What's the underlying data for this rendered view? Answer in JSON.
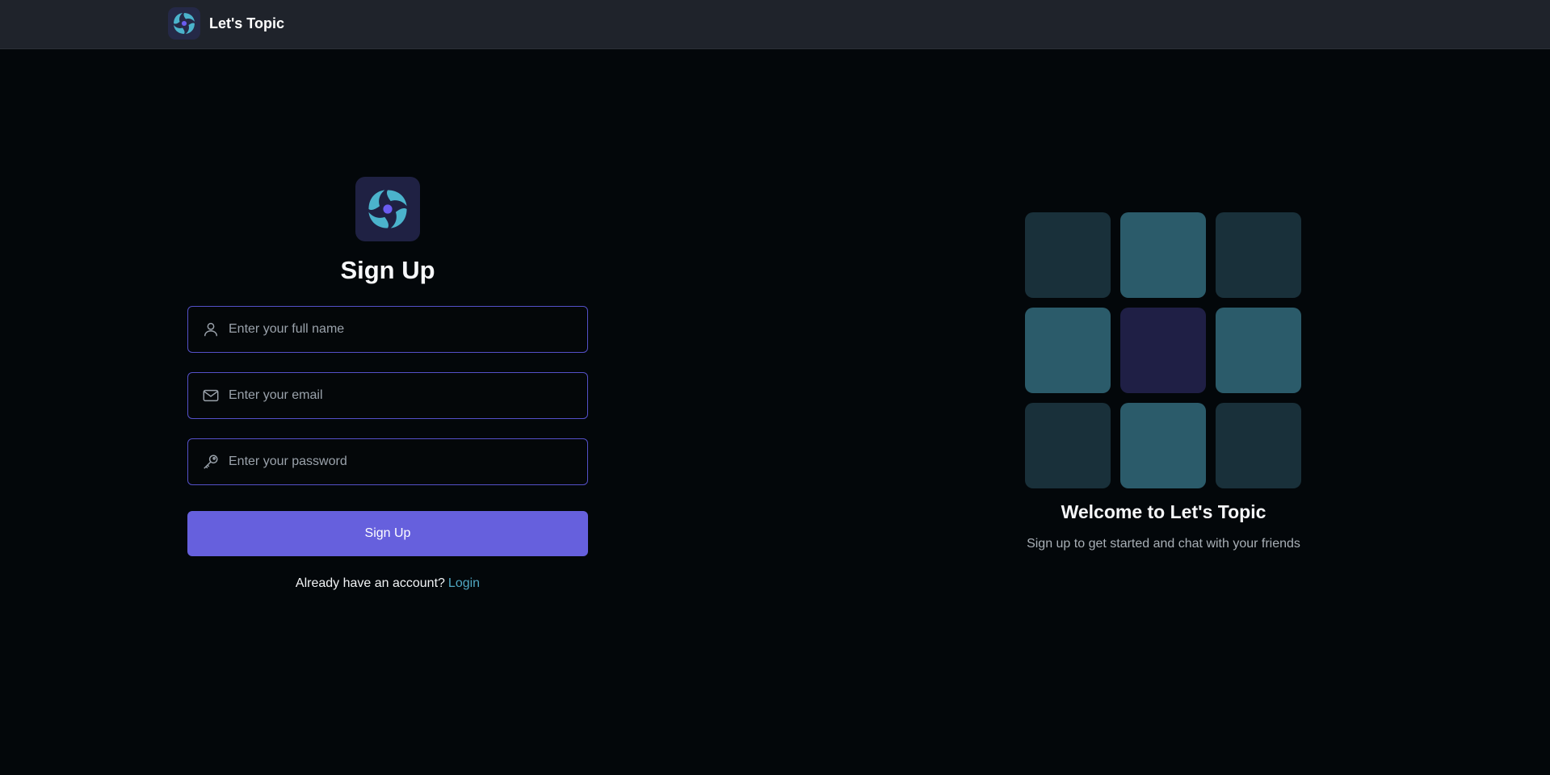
{
  "app": {
    "brand_name": "Let's Topic",
    "logo_icon": "swirl-logo-icon"
  },
  "signup": {
    "title": "Sign Up",
    "fields": [
      {
        "name": "full-name",
        "placeholder": "Enter your full name",
        "icon": "user-icon",
        "value": ""
      },
      {
        "name": "email",
        "placeholder": "Enter your email",
        "icon": "mail-icon",
        "value": ""
      },
      {
        "name": "password",
        "placeholder": "Enter your password",
        "icon": "key-icon",
        "value": ""
      }
    ],
    "submit_label": "Sign Up",
    "login_prompt": "Already have an account?",
    "login_link": "Login"
  },
  "welcome": {
    "title": "Welcome to Let's Topic",
    "subtitle": "Sign up to get started and chat with your friends",
    "tile_colors": [
      "#19303a",
      "#2b5b6a",
      "#19303a",
      "#2b5b6a",
      "#1f1f45",
      "#2b5b6a",
      "#19303a",
      "#2b5b6a",
      "#19303a"
    ]
  },
  "colors": {
    "accent": "#6660dd",
    "link": "#4fa7c2",
    "field_border": "#5450c8",
    "background": "#03070a",
    "topbar": "#1f232b"
  }
}
